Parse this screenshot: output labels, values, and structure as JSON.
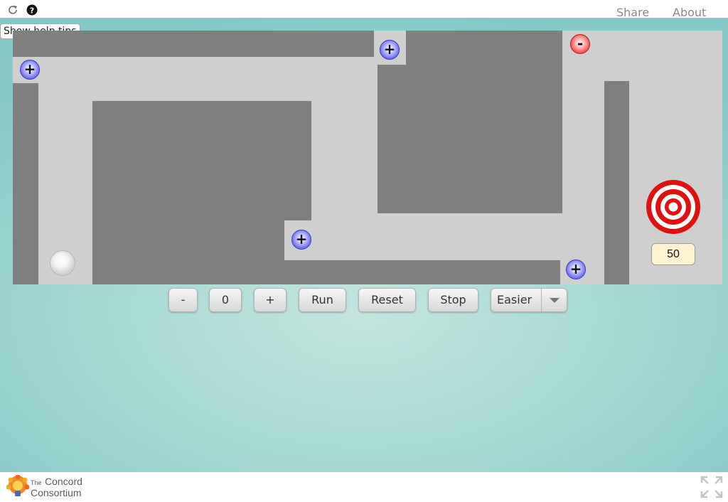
{
  "topbar": {
    "reload_icon": "reload-icon",
    "help_icon": "help-icon",
    "share_label": "Share",
    "about_label": "About",
    "tooltip_text": "Show help tips"
  },
  "game": {
    "charges": [
      {
        "sign": "+",
        "kind": "positive"
      },
      {
        "sign": "+",
        "kind": "positive"
      },
      {
        "sign": "-",
        "kind": "negative"
      },
      {
        "sign": "+",
        "kind": "positive"
      },
      {
        "sign": "+",
        "kind": "positive"
      }
    ],
    "target_score": "50",
    "colors": {
      "board": "#cfcfcf",
      "wall": "#808080",
      "positive_charge": "#5a5ae8",
      "negative_charge": "#e23c3c",
      "target_red": "#e01010"
    }
  },
  "controls": {
    "minus_label": "-",
    "value_label": "0",
    "plus_label": "+",
    "run_label": "Run",
    "reset_label": "Reset",
    "stop_label": "Stop",
    "difficulty_selected": "Easier"
  },
  "footer": {
    "logo_small": "The",
    "logo_concord": "Concord",
    "logo_consortium": "Consortium",
    "fullscreen_icon": "fullscreen-icon"
  }
}
